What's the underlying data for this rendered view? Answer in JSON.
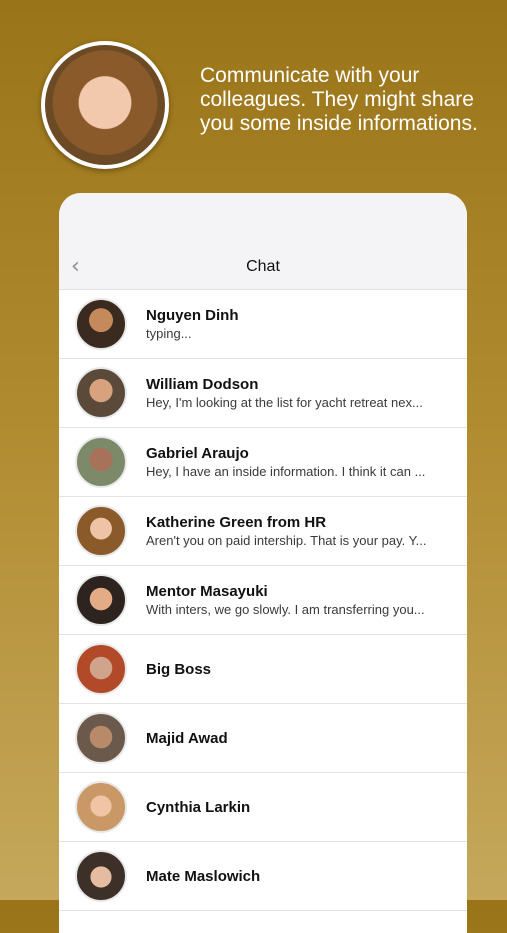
{
  "hero": {
    "text": "Communicate with your colleagues. They might share you some inside informations."
  },
  "navbar": {
    "title": "Chat",
    "back_icon": "chevron-left-icon"
  },
  "contacts": [
    {
      "name": "Nguyen Dinh",
      "preview": "typing...",
      "avatar_color": "#3b2a1f"
    },
    {
      "name": "William Dodson",
      "preview": "Hey, I'm looking at the list for yacht retreat nex...",
      "avatar_color": "#8a5f45"
    },
    {
      "name": "Gabriel Araujo",
      "preview": "Hey, I have an inside information. I think it can ...",
      "avatar_color": "#6e4b3a"
    },
    {
      "name": "Katherine Green from HR",
      "preview": "Aren't you on paid intership. That is your pay. Y...",
      "avatar_color": "#b07c5a"
    },
    {
      "name": "Mentor Masayuki",
      "preview": "With inters, we go slowly. I am transferring you...",
      "avatar_color": "#5a4638"
    },
    {
      "name": "Big Boss",
      "preview": "",
      "avatar_color": "#b24a2a"
    },
    {
      "name": "Majid Awad",
      "preview": "",
      "avatar_color": "#6b5a4c"
    },
    {
      "name": "Cynthia Larkin",
      "preview": "",
      "avatar_color": "#c99866"
    },
    {
      "name": "Mate Maslowich",
      "preview": "",
      "avatar_color": "#3d3029"
    }
  ]
}
